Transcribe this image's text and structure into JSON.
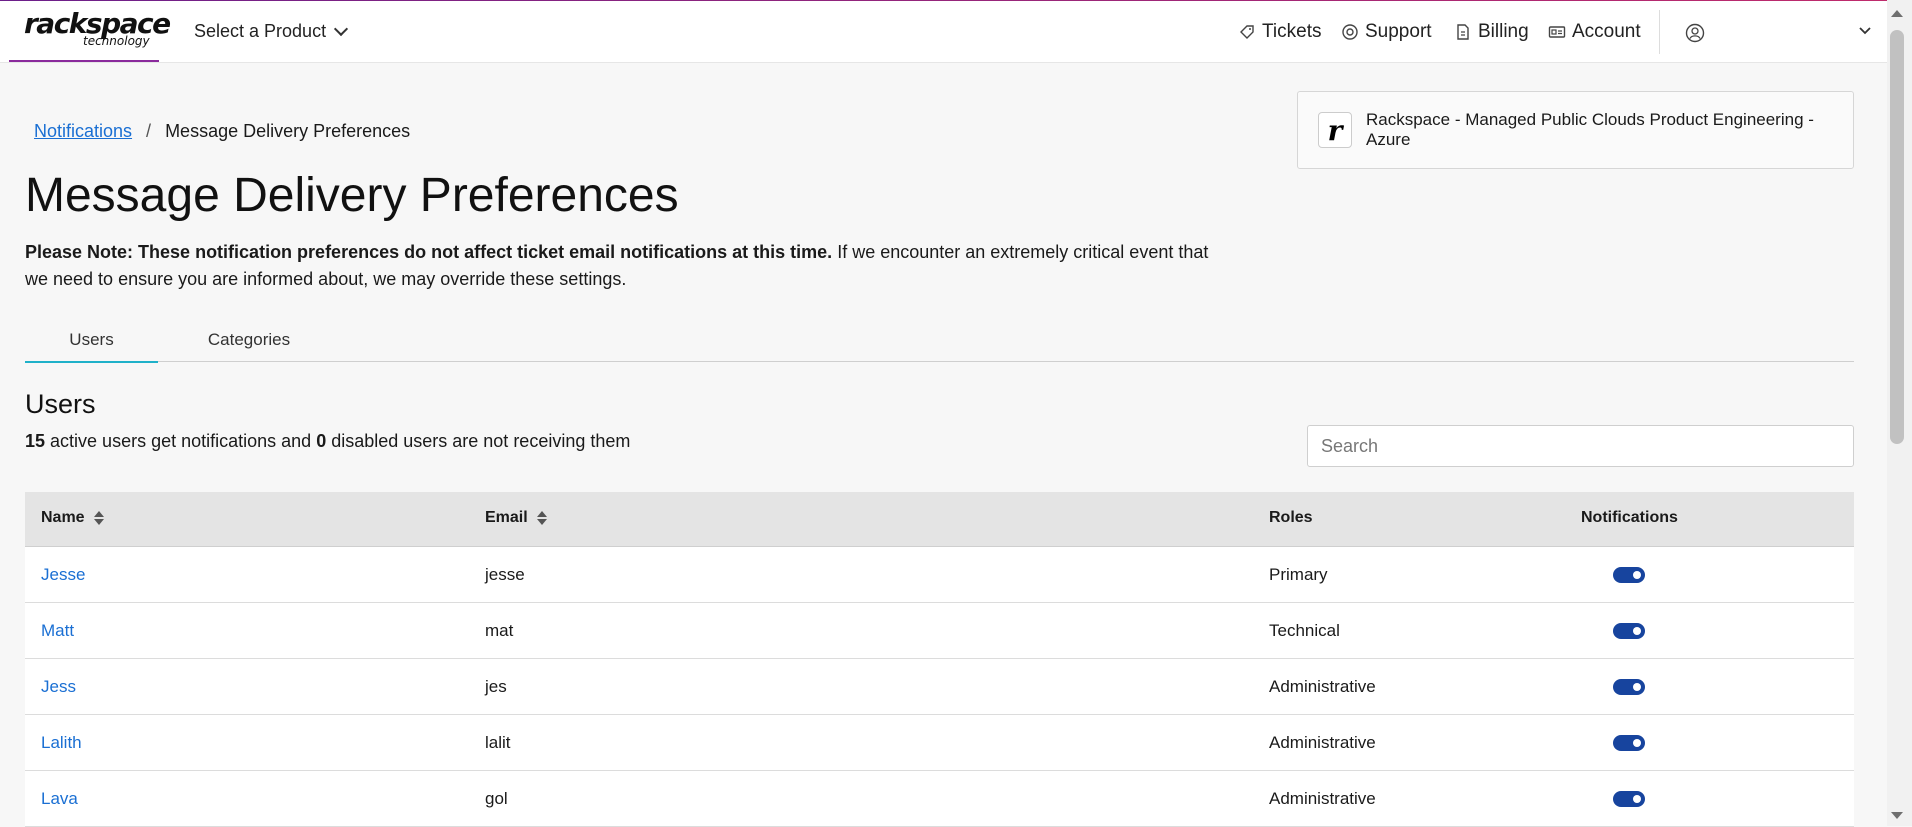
{
  "header": {
    "logo_main": "rackspace",
    "logo_sub": "technology",
    "product_select": "Select a Product",
    "nav": [
      {
        "label": "Tickets",
        "icon": "ticket-icon"
      },
      {
        "label": "Support",
        "icon": "lifebuoy-icon"
      },
      {
        "label": "Billing",
        "icon": "invoice-icon"
      },
      {
        "label": "Account",
        "icon": "id-card-icon"
      }
    ]
  },
  "breadcrumb": {
    "parent": "Notifications",
    "separator": "/",
    "current": "Message Delivery Preferences"
  },
  "account": {
    "badge": "r",
    "name": "Rackspace - Managed Public Clouds Product Engineering - Azure"
  },
  "page": {
    "title": "Message Delivery Preferences",
    "note_bold": "Please Note: These notification preferences do not affect ticket email notifications at this time.",
    "note_rest": " If we encounter an extremely critical event that we need to ensure you are informed about, we may override these settings."
  },
  "tabs": [
    {
      "label": "Users",
      "active": true
    },
    {
      "label": "Categories",
      "active": false
    }
  ],
  "users_section": {
    "heading": "Users",
    "active_count": "15",
    "summary_mid": " active users get notifications and ",
    "disabled_count": "0",
    "summary_end": " disabled users are not receiving them",
    "search_placeholder": "Search"
  },
  "table": {
    "columns": [
      "Name",
      "Email",
      "Roles",
      "Notifications"
    ],
    "rows": [
      {
        "name": "Jesse",
        "email": "jesse",
        "role": "Primary",
        "notifications": true
      },
      {
        "name": "Matt",
        "email": "mat",
        "role": "Technical",
        "notifications": true
      },
      {
        "name": "Jess",
        "email": "jes",
        "role": "Administrative",
        "notifications": true
      },
      {
        "name": "Lalith",
        "email": "lalit",
        "role": "Administrative",
        "notifications": true
      },
      {
        "name": "Lava",
        "email": "gol",
        "role": "Administrative",
        "notifications": true
      }
    ]
  },
  "colors": {
    "link": "#1a6fd3",
    "tab_active": "#1fb1c9",
    "toggle_on": "#17449e",
    "brand_accent": "#8a2a9c"
  }
}
